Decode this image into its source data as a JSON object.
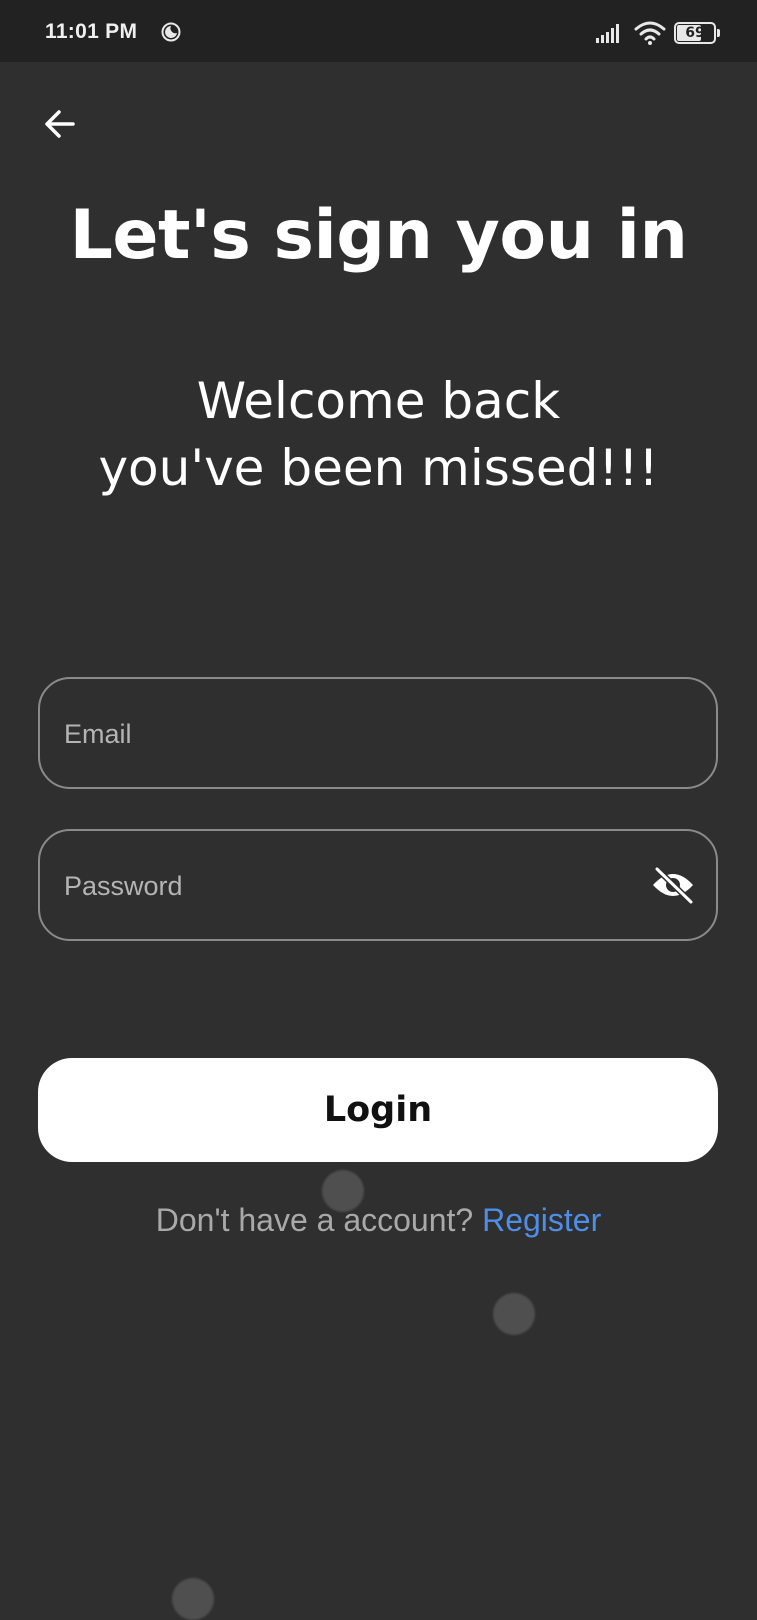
{
  "status_bar": {
    "time": "11:01 PM",
    "battery_level": "69",
    "icons": [
      "moon-icon",
      "signal-icon",
      "wifi-icon",
      "battery-icon"
    ]
  },
  "header": {
    "back_icon": "arrow-left-icon"
  },
  "main": {
    "title": "Let's sign you in",
    "subtitle_line1": "Welcome back",
    "subtitle_line2": "you've been missed!!!"
  },
  "form": {
    "email": {
      "value": "",
      "placeholder": "Email"
    },
    "password": {
      "value": "",
      "placeholder": "Password",
      "toggle_icon": "eye-off-icon"
    },
    "login_label": "Login"
  },
  "footer": {
    "prompt": "Don't have a account? ",
    "register_label": "Register"
  },
  "colors": {
    "background": "#2f2f30",
    "status_bar": "#222223",
    "link": "#4f8ee6",
    "button_bg": "#ffffff",
    "field_border": "#8a8a8a"
  }
}
